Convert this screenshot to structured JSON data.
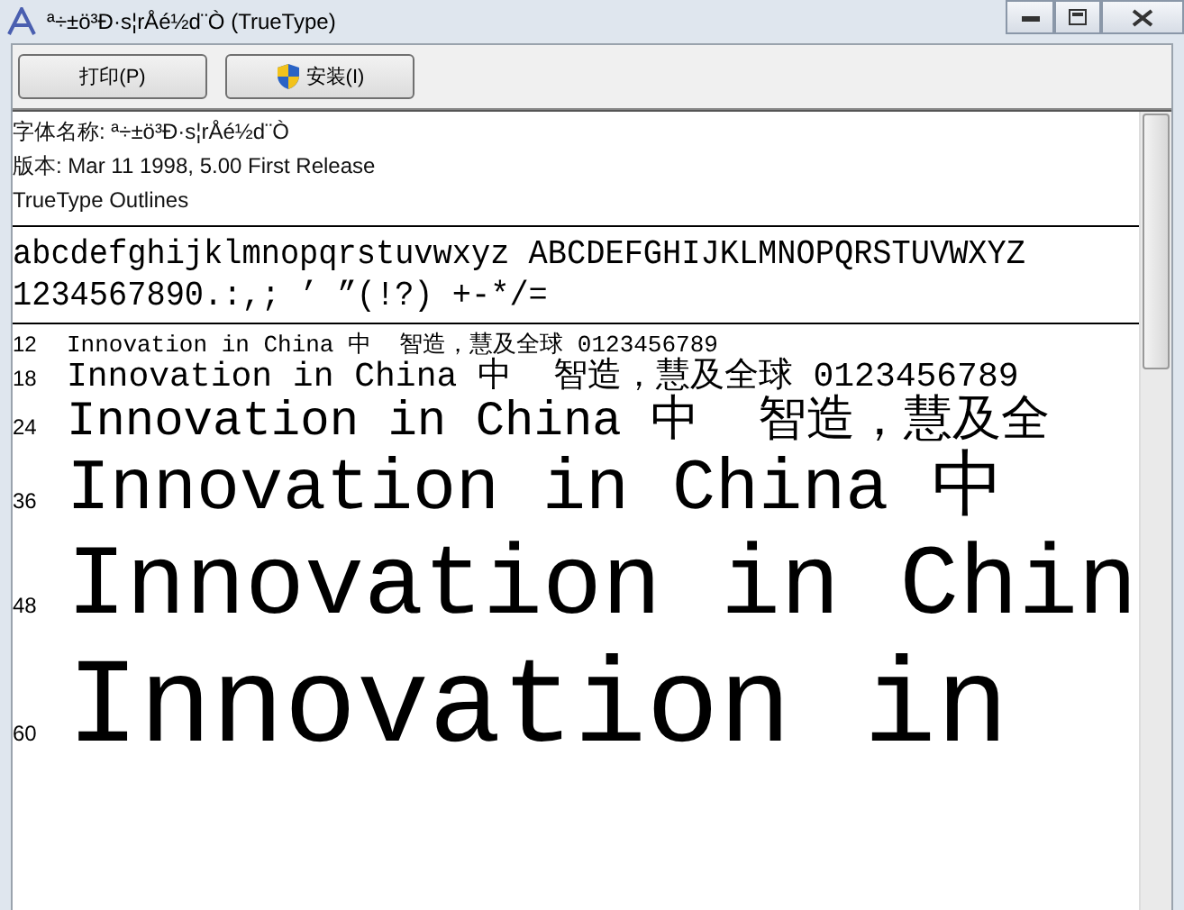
{
  "window": {
    "title": "ª÷±ö³Ð·s¦rÅé½d¨Ò (TrueType)"
  },
  "toolbar": {
    "buttons": [
      {
        "label": "打印(P)",
        "kind": "plain"
      },
      {
        "label": "安装(I)",
        "kind": "shield"
      }
    ]
  },
  "info": [
    "字体名称: ª÷±ö³Ð·s¦rÅé½d¨Ò",
    "版本: Mar 11 1998, 5.00 First Release",
    "TrueType Outlines"
  ],
  "charset": [
    "abcdefghijklmnopqrstuvwxyz ABCDEFGHIJKLMNOPQRSTUVWXYZ",
    "1234567890.:,; ’ ”(!?) +-*/="
  ],
  "samples": [
    {
      "size": "12",
      "text": "Innovation in China 中  智造，慧及全球 0123456789"
    },
    {
      "size": "18",
      "text": "Innovation in China 中  智造，慧及全球 0123456789"
    },
    {
      "size": "24",
      "text": "Innovation in China 中  智造，慧及全"
    },
    {
      "size": "36",
      "text": "Innovation in China 中"
    },
    {
      "size": "48",
      "text": "Innovation in Chin"
    },
    {
      "size": "60",
      "text": "Innovation in"
    }
  ]
}
